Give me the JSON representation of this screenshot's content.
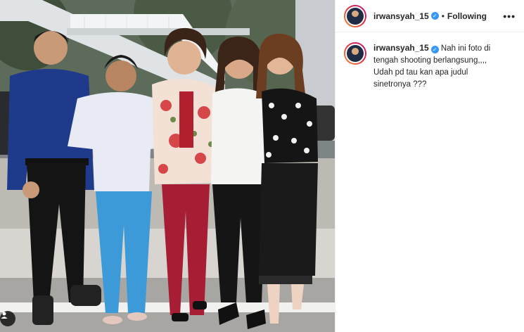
{
  "post": {
    "author": {
      "username": "irwansyah_15",
      "verified": true
    },
    "follow_status": "Following",
    "separator": "•",
    "more_label": "•••",
    "caption": {
      "username": "irwansyah_15",
      "text": "Nah ini foto di tengah shooting berlangsung,,,, Udah pd tau kan apa judul sinetronya ???"
    }
  },
  "colors": {
    "verified_badge": "#3897f0",
    "text": "#262626",
    "border": "#efefef"
  },
  "icons": {
    "verified": "verified-badge-icon",
    "more": "more-options-icon",
    "tag": "user-tag-icon"
  }
}
